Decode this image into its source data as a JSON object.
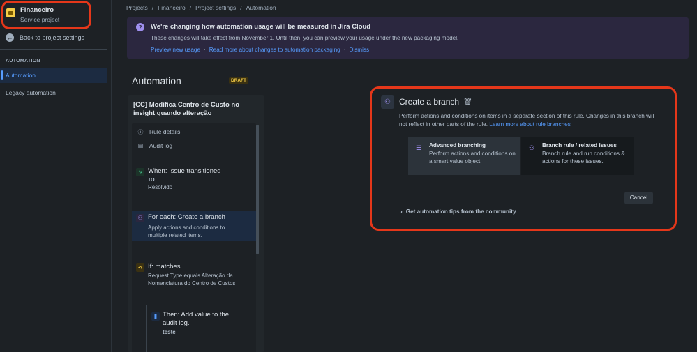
{
  "sidebar": {
    "project_name": "Financeiro",
    "project_type": "Service project",
    "back_label": "Back to project settings",
    "section_label": "AUTOMATION",
    "items": [
      {
        "label": "Automation"
      },
      {
        "label": "Legacy automation"
      }
    ]
  },
  "breadcrumb": [
    "Projects",
    "Financeiro",
    "Project settings",
    "Automation"
  ],
  "banner": {
    "title": "We're changing how automation usage will be measured in Jira Cloud",
    "text": "These changes will take effect from November 1. Until then, you can preview your usage under the new packaging model.",
    "links": [
      "Preview new usage",
      "Read more about changes to automation packaging",
      "Dismiss"
    ]
  },
  "page": {
    "title": "Automation",
    "status_badge": "DRAFT"
  },
  "rule": {
    "name": "[CC] Modifica Centro de Custo no insight quando alteração",
    "menu": [
      {
        "label": "Rule details",
        "icon": "info-icon"
      },
      {
        "label": "Audit log",
        "icon": "document-icon"
      }
    ],
    "steps": [
      {
        "title": "When: Issue transitioned",
        "sub_label": "TO",
        "sub": "Resolvido",
        "icon": "trigger-icon",
        "color": "#4bce97"
      },
      {
        "title": "For each: Create a branch",
        "sub": "Apply actions and conditions to multiple related items.",
        "icon": "branch-icon",
        "color": "#9f8fef"
      },
      {
        "title": "If: matches",
        "sub": "Request Type equals Alteração da Nomenclatura do Centro de Custos",
        "icon": "condition-icon",
        "color": "#f5cd47"
      },
      {
        "title": "Then: Add value to the audit log.",
        "sub": "teste",
        "icon": "action-icon",
        "color": "#579dff"
      }
    ]
  },
  "config": {
    "title": "Create a branch",
    "description": "Perform actions and conditions on items in a separate section of this rule. Changes in this branch will not reflect in other parts of the rule.",
    "learn_more": "Learn more about rule branches",
    "options": [
      {
        "title": "Advanced branching",
        "sub": "Perform actions and conditions on a smart value object.",
        "icon": "list-icon"
      },
      {
        "title": "Branch rule / related issues",
        "sub": "Branch rule and run conditions & actions for these issues.",
        "icon": "branch-icon"
      }
    ],
    "cancel_label": "Cancel",
    "tips_label": "Get automation tips from the community"
  },
  "colors": {
    "accent": "#579dff",
    "annotation": "#e5371a",
    "banner_bg": "#2b273f"
  }
}
